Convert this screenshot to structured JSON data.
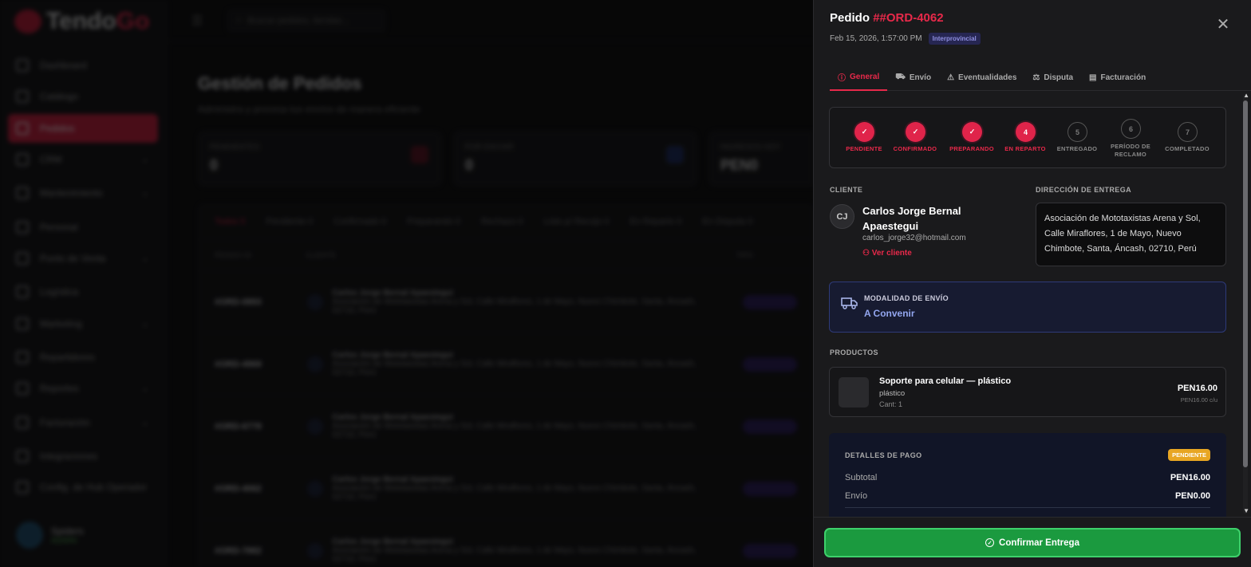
{
  "background": {
    "logo": {
      "part1": "Tendo",
      "part2": "Go"
    },
    "nav": [
      {
        "label": "Dashboard",
        "caret": false
      },
      {
        "label": "Catálogo",
        "caret": false
      },
      {
        "label": "Pedidos",
        "caret": false,
        "active": true
      },
      {
        "label": "CRM",
        "caret": true
      },
      {
        "label": "Mantenimiento",
        "caret": true
      },
      {
        "label": "Personal",
        "caret": false
      },
      {
        "label": "Punto de Venta",
        "caret": true
      },
      {
        "label": "Logística",
        "caret": false
      },
      {
        "label": "Marketing",
        "caret": true
      },
      {
        "label": "Repartidores",
        "caret": false
      },
      {
        "label": "Reportes",
        "caret": true
      },
      {
        "label": "Facturación",
        "caret": true
      },
      {
        "label": "Integraciones",
        "caret": false
      },
      {
        "label": "Config. de Hub Operador",
        "caret": false
      }
    ],
    "user": {
      "name": "Spiders",
      "role": "ADMIN"
    },
    "search_placeholder": "Buscar pedidos, tiendas...",
    "page_title": "Gestión de Pedidos",
    "page_subtitle": "Administra y procesa tus envíos de manera eficiente",
    "stats": [
      {
        "label": "PENDIENTES",
        "value": "0"
      },
      {
        "label": "POR ENVIAR",
        "value": "0"
      },
      {
        "label": "INGRESOS HOY",
        "value": "PEN0"
      }
    ],
    "filters": [
      "Todos 5",
      "Pendiente 0",
      "Confirmado 0",
      "Preparando 0",
      "Rechazo 0",
      "Listo p/ Recojo 0",
      "En Reparto 0",
      "En Disputa 0"
    ],
    "columns": [
      "PEDIDO ID",
      "CLIENTE",
      "TIPO"
    ],
    "rows": [
      {
        "id": "#ORD-0893",
        "name": "Carlos Jorge Bernal Apaestegui",
        "addr": "Asociación de Mototaxistas Arena y Sol, Calle Miraflores, 1 de Mayo, Nuevo Chimbote, Santa, Áncash, 02710, Perú"
      },
      {
        "id": "#ORD-4969",
        "name": "Carlos Jorge Bernal Apaestegui",
        "addr": "Asociación de Mototaxistas Arena y Sol, Calle Miraflores, 1 de Mayo, Nuevo Chimbote, Santa, Áncash, 02710, Perú"
      },
      {
        "id": "#ORD-6778",
        "name": "Carlos Jorge Bernal Apaestegui",
        "addr": "Asociación de Mototaxistas Arena y Sol, Calle Miraflores, 1 de Mayo, Nuevo Chimbote, Santa, Áncash, 02710, Perú"
      },
      {
        "id": "#ORD-4062",
        "name": "Carlos Jorge Bernal Apaestegui",
        "addr": "Asociación de Mototaxistas Arena y Sol, Calle Miraflores, 1 de Mayo, Nuevo Chimbote, Santa, Áncash, 02710, Perú"
      },
      {
        "id": "#ORD-7882",
        "name": "Carlos Jorge Bernal Apaestegui",
        "addr": "Asociación de Mototaxistas Arena y Sol, Calle Miraflores, 1 de Mayo, Nuevo Chimbote, Santa, Áncash, 02710, Perú"
      }
    ]
  },
  "panel": {
    "title_prefix": "Pedido",
    "order_id": "##ORD-4062",
    "datetime": "Feb 15, 2026, 1:57:00 PM",
    "tag": "Interprovincial",
    "close_icon": "x-icon",
    "tabs": [
      {
        "label": "General",
        "icon": "ⓘ",
        "active": true
      },
      {
        "label": "Envío",
        "icon": "⛟",
        "active": false
      },
      {
        "label": "Eventualidades",
        "icon": "⚠",
        "active": false
      },
      {
        "label": "Disputa",
        "icon": "⚖",
        "active": false
      },
      {
        "label": "Facturación",
        "icon": "▤",
        "active": false
      }
    ],
    "steps": [
      {
        "num": "4",
        "label": "PENDIENTE",
        "done": true
      },
      {
        "num": "4",
        "label": "CONFIRMADO",
        "done": true
      },
      {
        "num": "4",
        "label": "PREPARANDO",
        "done": true
      },
      {
        "num": "4",
        "label": "EN REPARTO",
        "done": true,
        "current": true
      },
      {
        "num": "5",
        "label": "ENTREGADO",
        "done": false
      },
      {
        "num": "6",
        "label": "PERÍODO DE RECLAMO",
        "done": false
      },
      {
        "num": "7",
        "label": "COMPLETADO",
        "done": false
      }
    ],
    "client_label": "CLIENTE",
    "client_initials": "CJ",
    "client_name": "Carlos Jorge Bernal Apaestegui",
    "client_email": "carlos_jorge32@hotmail.com",
    "client_link": "Ver cliente",
    "address_label": "DIRECCIÓN DE ENTREGA",
    "address": "Asociación de Mototaxistas Arena y Sol, Calle Miraflores, 1 de Mayo, Nuevo Chimbote, Santa, Áncash, 02710, Perú",
    "shipping_label": "MODALIDAD DE ENVÍO",
    "shipping_value": "A Convenir",
    "products_label": "PRODUCTOS",
    "product": {
      "name": "Soporte para celular — plástico",
      "variant": "plástico",
      "qty": "Cant: 1",
      "price": "PEN16.00",
      "unit": "PEN16.00 c/u"
    },
    "payment": {
      "title": "DETALLES DE PAGO",
      "badge": "PENDIENTE",
      "subtotal_label": "Subtotal",
      "subtotal": "PEN16.00",
      "shipping_label": "Envío",
      "shipping": "PEN0.00"
    },
    "confirm_label": "Confirmar Entrega"
  },
  "colors": {
    "accent": "#e8294a",
    "success": "#1b9a3f",
    "warning": "#e8a623"
  }
}
